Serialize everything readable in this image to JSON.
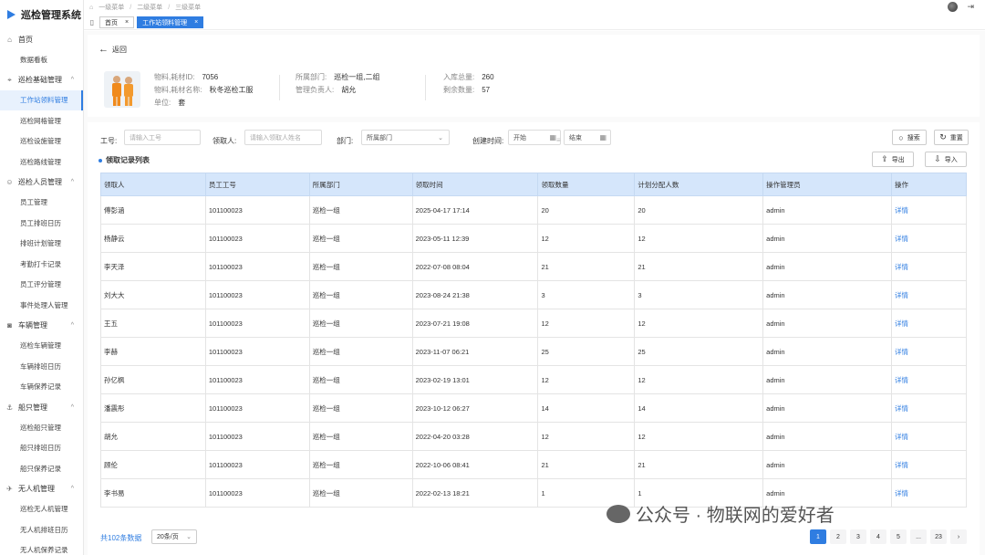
{
  "app": {
    "title": "巡检管理系统"
  },
  "sidebar": {
    "groups": [
      {
        "label": "首页",
        "icon": "home-icon",
        "items": [
          "数据看板"
        ]
      },
      {
        "label": "巡检基础管理",
        "icon": "inspection-icon",
        "items": [
          "工作站领料管理",
          "巡检网格管理",
          "巡检设施管理",
          "巡检路线管理"
        ]
      },
      {
        "label": "巡检人员管理",
        "icon": "person-icon",
        "items": [
          "员工管理",
          "员工排班日历",
          "排班计划管理",
          "考勤打卡记录",
          "员工评分管理",
          "事件处理人管理"
        ]
      },
      {
        "label": "车辆管理",
        "icon": "car-icon",
        "items": [
          "巡检车辆管理",
          "车辆排班日历",
          "车辆保养记录"
        ]
      },
      {
        "label": "船只管理",
        "icon": "ship-icon",
        "items": [
          "巡检船只管理",
          "船只排班日历",
          "船只保养记录"
        ]
      },
      {
        "label": "无人机管理",
        "icon": "drone-icon",
        "items": [
          "巡检无人机管理",
          "无人机排班日历",
          "无人机保养记录"
        ]
      }
    ],
    "active_item": "工作站领料管理"
  },
  "breadcrumb": [
    "一级菜单",
    "二级菜单",
    "三级菜单"
  ],
  "tabs": {
    "home": "首页",
    "active": "工作站领料管理"
  },
  "detail": {
    "back": "返回",
    "material_id_label": "物料,耗材ID:",
    "material_id": "7056",
    "material_name_label": "物料,耗材名称:",
    "material_name": "秋冬巡检工服",
    "unit_label": "单位:",
    "unit": "套",
    "dept_label": "所属部门:",
    "dept": "巡检一组,二组",
    "manager_label": "管理负责人:",
    "manager": "胡允",
    "stock_in_label": "入库总量:",
    "stock_in": "260",
    "remaining_label": "剩余数量:",
    "remaining": "57"
  },
  "filters": {
    "emp_no_label": "工号:",
    "emp_no_placeholder": "请输入工号",
    "receiver_label": "领取人:",
    "receiver_placeholder": "请输入领取人姓名",
    "dept_label": "部门:",
    "dept_value": "所属部门",
    "created_label": "创建时间:",
    "start": "开始",
    "end": "结束",
    "search": "搜索",
    "reset": "重置",
    "export": "导出",
    "import": "导入"
  },
  "list_title": "领取记录列表",
  "table": {
    "headers": [
      "领取人",
      "员工工号",
      "所属部门",
      "领取时间",
      "领取数量",
      "计划分配人数",
      "操作管理员",
      "操作"
    ],
    "rows": [
      [
        "傅彭涵",
        "101100023",
        "巡检一组",
        "2025-04-17 17:14",
        "20",
        "20",
        "admin",
        "详情"
      ],
      [
        "杨静云",
        "101100023",
        "巡检一组",
        "2023-05-11 12:39",
        "12",
        "12",
        "admin",
        "详情"
      ],
      [
        "李天泽",
        "101100023",
        "巡检一组",
        "2022-07-08 08:04",
        "21",
        "21",
        "admin",
        "详情"
      ],
      [
        "刘大大",
        "101100023",
        "巡检一组",
        "2023-08-24 21:38",
        "3",
        "3",
        "admin",
        "详情"
      ],
      [
        "王五",
        "101100023",
        "巡检一组",
        "2023-07-21 19:08",
        "12",
        "12",
        "admin",
        "详情"
      ],
      [
        "李赫",
        "101100023",
        "巡检一组",
        "2023-11-07 06:21",
        "25",
        "25",
        "admin",
        "详情"
      ],
      [
        "孙亿枫",
        "101100023",
        "巡检一组",
        "2023-02-19 13:01",
        "12",
        "12",
        "admin",
        "详情"
      ],
      [
        "潘震彤",
        "101100023",
        "巡检一组",
        "2023-10-12 06:27",
        "14",
        "14",
        "admin",
        "详情"
      ],
      [
        "胡允",
        "101100023",
        "巡检一组",
        "2022-04-20 03:28",
        "12",
        "12",
        "admin",
        "详情"
      ],
      [
        "顾伦",
        "101100023",
        "巡检一组",
        "2022-10-06 08:41",
        "21",
        "21",
        "admin",
        "详情"
      ],
      [
        "李书易",
        "101100023",
        "巡检一组",
        "2022-02-13 18:21",
        "1",
        "1",
        "admin",
        "详情"
      ]
    ]
  },
  "pagination": {
    "total": "共102条数据",
    "page_size": "20条/页",
    "pages": [
      "1",
      "2",
      "3",
      "4",
      "5",
      "...",
      "23"
    ],
    "current": "1"
  },
  "watermark": "公众号 · 物联网的爱好者"
}
